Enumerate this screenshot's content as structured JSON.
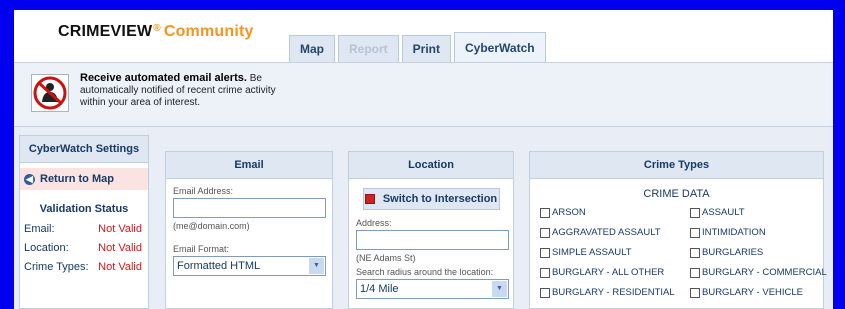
{
  "header": {
    "logo_brand": "CRIMEVIEW",
    "logo_reg": "®",
    "logo_community": "Community"
  },
  "tabs": [
    {
      "label": "Map",
      "state": "enabled"
    },
    {
      "label": "Report",
      "state": "disabled"
    },
    {
      "label": "Print",
      "state": "enabled"
    },
    {
      "label": "CyberWatch",
      "state": "active"
    }
  ],
  "alert": {
    "icon": "no-crime-icon",
    "title": "Receive automated email alerts.",
    "body": "Be automatically notified of recent crime activity within your area of interest."
  },
  "sidebar": {
    "title": "CyberWatch Settings",
    "return_label": "Return to Map",
    "validation_title": "Validation Status",
    "items": [
      {
        "label": "Email:",
        "status": "Not Valid"
      },
      {
        "label": "Location:",
        "status": "Not Valid"
      },
      {
        "label": "Crime Types:",
        "status": "Not Valid"
      }
    ]
  },
  "email": {
    "title": "Email",
    "address_label": "Email Address:",
    "address_value": "",
    "address_hint": "(me@domain.com)",
    "format_label": "Email Format:",
    "format_value": "Formatted HTML"
  },
  "location": {
    "title": "Location",
    "switch_label": "Switch to Intersection",
    "address_label": "Address:",
    "address_value": "",
    "address_hint": "(NE Adams St)",
    "radius_label": "Search radius around the location:",
    "radius_value": "1/4 Mile"
  },
  "crime_types": {
    "title": "Crime Types",
    "subtitle": "CRIME DATA",
    "items": [
      "ARSON",
      "ASSAULT",
      "AGGRAVATED ASSAULT",
      "INTIMIDATION",
      "SIMPLE ASSAULT",
      "BURGLARIES",
      "BURGLARY - ALL OTHER",
      "BURGLARY - COMMERCIAL",
      "BURGLARY - RESIDENTIAL",
      "BURGLARY - VEHICLE"
    ]
  },
  "colors": {
    "frame": "#0000ee",
    "accent_orange": "#f7941d",
    "invalid_red": "#d21818",
    "navy": "#173a65"
  }
}
